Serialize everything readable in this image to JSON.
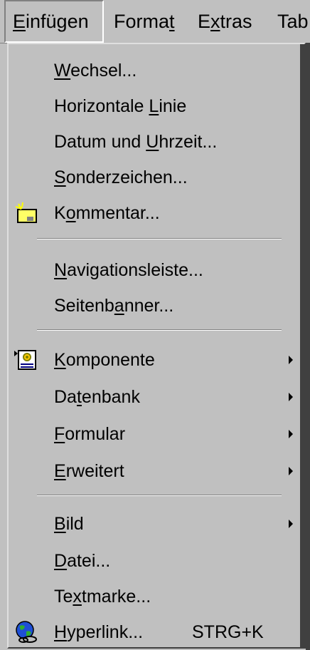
{
  "menubar": {
    "items": [
      {
        "label": "Einfügen",
        "mnemonic": "E"
      },
      {
        "label": "Format",
        "mnemonic": "t"
      },
      {
        "label": "Extras",
        "mnemonic": "x"
      },
      {
        "label": "Tab"
      }
    ]
  },
  "menu": {
    "items": [
      {
        "label": "Wechsel...",
        "mnemonic": "W"
      },
      {
        "label": "Horizontale Linie",
        "mnemonic": "L"
      },
      {
        "label": "Datum und Uhrzeit...",
        "mnemonic": "U"
      },
      {
        "label": "Sonderzeichen...",
        "mnemonic": "S"
      },
      {
        "label": "Kommentar...",
        "icon": "comment-icon",
        "mnemonic": "o"
      },
      {
        "label": "Navigationsleiste...",
        "mnemonic": "N"
      },
      {
        "label": "Seitenbanner...",
        "mnemonic": "a"
      },
      {
        "label": "Komponente",
        "icon": "component-icon",
        "submenu": true,
        "mnemonic": "K"
      },
      {
        "label": "Datenbank",
        "submenu": true,
        "mnemonic": "t"
      },
      {
        "label": "Formular",
        "submenu": true,
        "mnemonic": "F"
      },
      {
        "label": "Erweitert",
        "submenu": true,
        "mnemonic": "E"
      },
      {
        "label": "Bild",
        "submenu": true,
        "mnemonic": "B"
      },
      {
        "label": "Datei...",
        "mnemonic": "D"
      },
      {
        "label": "Textmarke...",
        "mnemonic": "x"
      },
      {
        "label": "Hyperlink...",
        "icon": "hyperlink-globe-icon",
        "shortcut": "STRG+K",
        "mnemonic": "H"
      }
    ]
  },
  "colors": {
    "face": "#c0c0c0",
    "shadow": "#808080",
    "highlight": "#ffffff",
    "dark": "#404040"
  }
}
